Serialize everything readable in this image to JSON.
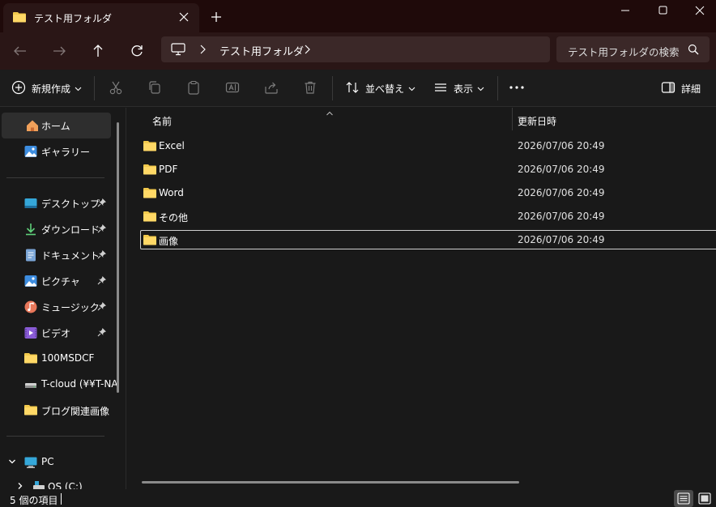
{
  "window": {
    "tab_title": "テスト用フォルダ"
  },
  "address": {
    "location": "テスト用フォルダ"
  },
  "search": {
    "placeholder": "テスト用フォルダの検索"
  },
  "commands": {
    "new": "新規作成",
    "sort": "並べ替え",
    "view": "表示",
    "details": "詳細"
  },
  "sidebar": {
    "home": "ホーム",
    "gallery": "ギャラリー",
    "desktop": "デスクトップ",
    "downloads": "ダウンロード",
    "documents": "ドキュメント",
    "pictures": "ピクチャ",
    "music": "ミュージック",
    "videos": "ビデオ",
    "msdcf": "100MSDCF",
    "tcloud": "T-cloud (¥¥T-NA",
    "blog": "ブログ関連画像",
    "pc": "PC",
    "os": "OS (C:)"
  },
  "list": {
    "col_name": "名前",
    "col_date": "更新日時",
    "rows": [
      {
        "name": "Excel",
        "date": "2026/07/06 20:49"
      },
      {
        "name": "PDF",
        "date": "2026/07/06 20:49"
      },
      {
        "name": "Word",
        "date": "2026/07/06 20:49"
      },
      {
        "name": "その他",
        "date": "2026/07/06 20:49"
      },
      {
        "name": "画像",
        "date": "2026/07/06 20:49"
      }
    ]
  },
  "status": {
    "count": "5 個の項目"
  },
  "colors": {
    "folder": "#f2c94c",
    "title_bg": "#1f0a0a",
    "nav_bg": "#2a1616",
    "content_bg": "#191919"
  }
}
